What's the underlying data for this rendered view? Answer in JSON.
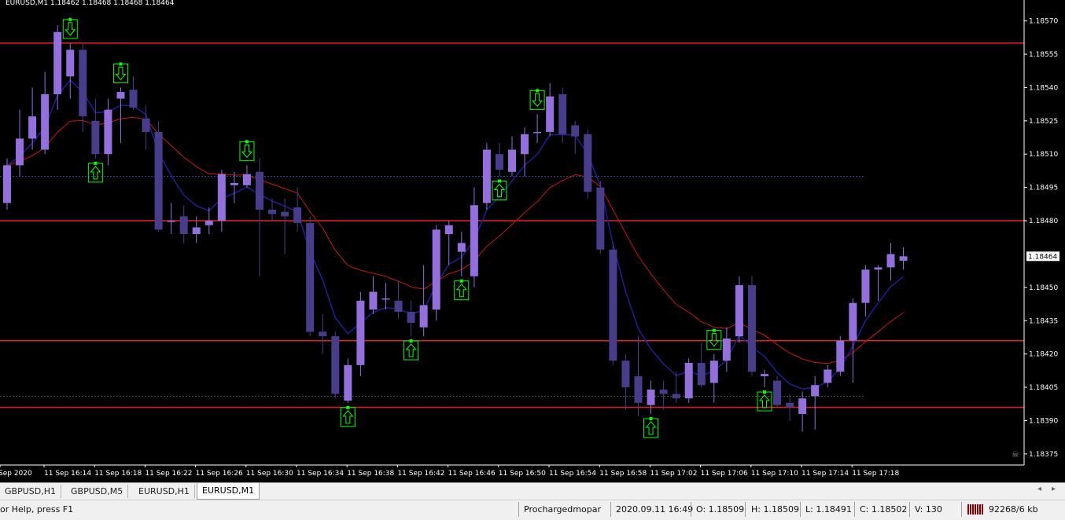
{
  "window": {
    "title": "EURUSD,M1  1.18462 1.18468 1.18468 1.18464"
  },
  "chart": {
    "background": "#000000",
    "bull_color": "#9370db",
    "bear_color": "#483d8b",
    "level_color": "#e0202a",
    "ma_fast_color": "#1e1e96",
    "ma_slow_color": "#c81414",
    "signal_color": "#00ff00",
    "current_price": "1.18464",
    "price_ticks": [
      "1.18570",
      "1.18555",
      "1.18540",
      "1.18525",
      "1.18510",
      "1.18495",
      "1.18480",
      "1.18450",
      "1.18435",
      "1.18420",
      "1.18405",
      "1.18390",
      "1.18375"
    ],
    "time_ticks": [
      "Sep 2020",
      "11 Sep 16:14",
      "11 Sep 16:18",
      "11 Sep 16:22",
      "11 Sep 16:26",
      "11 Sep 16:30",
      "11 Sep 16:34",
      "11 Sep 16:38",
      "11 Sep 16:42",
      "11 Sep 16:46",
      "11 Sep 16:50",
      "11 Sep 16:54",
      "11 Sep 16:58",
      "11 Sep 17:02",
      "11 Sep 17:06",
      "11 Sep 17:10",
      "11 Sep 17:14",
      "11 Sep 17:18"
    ],
    "horizontal_levels": [
      1.1856,
      1.1848,
      1.18426,
      1.18396
    ],
    "dotted_levels": [
      1.185,
      1.18401
    ]
  },
  "chart_data": {
    "type": "candlestick",
    "symbol": "EURUSD",
    "timeframe": "M1",
    "ylim": [
      1.1837,
      1.18578
    ],
    "candles": [
      {
        "o": 1.18488,
        "h": 1.18508,
        "l": 1.18485,
        "c": 1.18505
      },
      {
        "o": 1.18505,
        "h": 1.1853,
        "l": 1.185,
        "c": 1.18517
      },
      {
        "o": 1.18517,
        "h": 1.1854,
        "l": 1.18512,
        "c": 1.18527
      },
      {
        "o": 1.18512,
        "h": 1.18547,
        "l": 1.1851,
        "c": 1.18537
      },
      {
        "o": 1.18537,
        "h": 1.18568,
        "l": 1.1853,
        "c": 1.18565
      },
      {
        "o": 1.18545,
        "h": 1.1856,
        "l": 1.18535,
        "c": 1.18557
      },
      {
        "o": 1.18557,
        "h": 1.1856,
        "l": 1.1852,
        "c": 1.18527
      },
      {
        "o": 1.18525,
        "h": 1.18535,
        "l": 1.18508,
        "c": 1.1851
      },
      {
        "o": 1.1851,
        "h": 1.18535,
        "l": 1.18505,
        "c": 1.1853
      },
      {
        "o": 1.18535,
        "h": 1.1854,
        "l": 1.18515,
        "c": 1.18538
      },
      {
        "o": 1.18539,
        "h": 1.18545,
        "l": 1.1853,
        "c": 1.18531
      },
      {
        "o": 1.18526,
        "h": 1.18532,
        "l": 1.18512,
        "c": 1.1852
      },
      {
        "o": 1.1852,
        "h": 1.18525,
        "l": 1.18475,
        "c": 1.18476
      },
      {
        "o": 1.1848,
        "h": 1.18488,
        "l": 1.18474,
        "c": 1.1848
      },
      {
        "o": 1.18482,
        "h": 1.18487,
        "l": 1.1847,
        "c": 1.18474
      },
      {
        "o": 1.18474,
        "h": 1.18482,
        "l": 1.1847,
        "c": 1.18477
      },
      {
        "o": 1.18478,
        "h": 1.18486,
        "l": 1.18474,
        "c": 1.1848
      },
      {
        "o": 1.1848,
        "h": 1.18503,
        "l": 1.18475,
        "c": 1.18501
      },
      {
        "o": 1.18496,
        "h": 1.18502,
        "l": 1.18488,
        "c": 1.18497
      },
      {
        "o": 1.18496,
        "h": 1.18505,
        "l": 1.18495,
        "c": 1.18501
      },
      {
        "o": 1.18502,
        "h": 1.18508,
        "l": 1.18455,
        "c": 1.18485
      },
      {
        "o": 1.18485,
        "h": 1.1849,
        "l": 1.1848,
        "c": 1.18483
      },
      {
        "o": 1.18484,
        "h": 1.1849,
        "l": 1.18465,
        "c": 1.18482
      },
      {
        "o": 1.18486,
        "h": 1.18495,
        "l": 1.18475,
        "c": 1.18479
      },
      {
        "o": 1.18479,
        "h": 1.18482,
        "l": 1.18428,
        "c": 1.1843
      },
      {
        "o": 1.1843,
        "h": 1.18438,
        "l": 1.1842,
        "c": 1.18428
      },
      {
        "o": 1.18428,
        "h": 1.1843,
        "l": 1.184,
        "c": 1.18402
      },
      {
        "o": 1.18399,
        "h": 1.18418,
        "l": 1.18398,
        "c": 1.18415
      },
      {
        "o": 1.18415,
        "h": 1.18448,
        "l": 1.1841,
        "c": 1.18444
      },
      {
        "o": 1.1844,
        "h": 1.18455,
        "l": 1.18438,
        "c": 1.18448
      },
      {
        "o": 1.18445,
        "h": 1.18452,
        "l": 1.1844,
        "c": 1.18445
      },
      {
        "o": 1.18444,
        "h": 1.18453,
        "l": 1.18436,
        "c": 1.18439
      },
      {
        "o": 1.18439,
        "h": 1.18444,
        "l": 1.18428,
        "c": 1.18434
      },
      {
        "o": 1.18432,
        "h": 1.1846,
        "l": 1.18428,
        "c": 1.18442
      },
      {
        "o": 1.1844,
        "h": 1.18478,
        "l": 1.18435,
        "c": 1.18476
      },
      {
        "o": 1.18474,
        "h": 1.1848,
        "l": 1.1846,
        "c": 1.18478
      },
      {
        "o": 1.18466,
        "h": 1.18475,
        "l": 1.18455,
        "c": 1.1847
      },
      {
        "o": 1.18455,
        "h": 1.18495,
        "l": 1.1845,
        "c": 1.18487
      },
      {
        "o": 1.18488,
        "h": 1.18515,
        "l": 1.18485,
        "c": 1.18512
      },
      {
        "o": 1.1851,
        "h": 1.18515,
        "l": 1.185,
        "c": 1.18503
      },
      {
        "o": 1.18502,
        "h": 1.18518,
        "l": 1.185,
        "c": 1.18512
      },
      {
        "o": 1.1851,
        "h": 1.18522,
        "l": 1.185,
        "c": 1.18519
      },
      {
        "o": 1.1852,
        "h": 1.18528,
        "l": 1.18515,
        "c": 1.1852
      },
      {
        "o": 1.1852,
        "h": 1.18542,
        "l": 1.18518,
        "c": 1.18536
      },
      {
        "o": 1.18537,
        "h": 1.1854,
        "l": 1.18515,
        "c": 1.18519
      },
      {
        "o": 1.18523,
        "h": 1.18525,
        "l": 1.1851,
        "c": 1.18518
      },
      {
        "o": 1.18519,
        "h": 1.18521,
        "l": 1.1849,
        "c": 1.18493
      },
      {
        "o": 1.18495,
        "h": 1.18498,
        "l": 1.18465,
        "c": 1.18467
      },
      {
        "o": 1.18467,
        "h": 1.1847,
        "l": 1.18415,
        "c": 1.18417
      },
      {
        "o": 1.18417,
        "h": 1.1842,
        "l": 1.18395,
        "c": 1.18405
      },
      {
        "o": 1.1841,
        "h": 1.18428,
        "l": 1.18392,
        "c": 1.18398
      },
      {
        "o": 1.18397,
        "h": 1.18408,
        "l": 1.18393,
        "c": 1.18404
      },
      {
        "o": 1.18404,
        "h": 1.18408,
        "l": 1.18395,
        "c": 1.18402
      },
      {
        "o": 1.18402,
        "h": 1.18412,
        "l": 1.18398,
        "c": 1.184
      },
      {
        "o": 1.184,
        "h": 1.18418,
        "l": 1.18398,
        "c": 1.18416
      },
      {
        "o": 1.18416,
        "h": 1.18425,
        "l": 1.18405,
        "c": 1.18406
      },
      {
        "o": 1.18407,
        "h": 1.1842,
        "l": 1.18398,
        "c": 1.18417
      },
      {
        "o": 1.18417,
        "h": 1.18432,
        "l": 1.18412,
        "c": 1.18427
      },
      {
        "o": 1.18428,
        "h": 1.18455,
        "l": 1.18425,
        "c": 1.18451
      },
      {
        "o": 1.18451,
        "h": 1.18455,
        "l": 1.1841,
        "c": 1.18412
      },
      {
        "o": 1.1841,
        "h": 1.18413,
        "l": 1.18405,
        "c": 1.18411
      },
      {
        "o": 1.18408,
        "h": 1.1841,
        "l": 1.18396,
        "c": 1.18397
      },
      {
        "o": 1.18398,
        "h": 1.18402,
        "l": 1.1839,
        "c": 1.18396
      },
      {
        "o": 1.18393,
        "h": 1.18403,
        "l": 1.18385,
        "c": 1.184
      },
      {
        "o": 1.18401,
        "h": 1.1841,
        "l": 1.18386,
        "c": 1.18406
      },
      {
        "o": 1.18407,
        "h": 1.18415,
        "l": 1.18405,
        "c": 1.18413
      },
      {
        "o": 1.18412,
        "h": 1.18428,
        "l": 1.1841,
        "c": 1.18426
      },
      {
        "o": 1.18426,
        "h": 1.18445,
        "l": 1.18407,
        "c": 1.18443
      },
      {
        "o": 1.18443,
        "h": 1.1846,
        "l": 1.18437,
        "c": 1.18458
      },
      {
        "o": 1.18458,
        "h": 1.1846,
        "l": 1.18444,
        "c": 1.18459
      },
      {
        "o": 1.18459,
        "h": 1.1847,
        "l": 1.18453,
        "c": 1.18465
      },
      {
        "o": 1.18462,
        "h": 1.18468,
        "l": 1.18458,
        "c": 1.18464
      }
    ],
    "signals": [
      {
        "dir": "down",
        "candle": 5
      },
      {
        "dir": "up",
        "candle": 7
      },
      {
        "dir": "down",
        "candle": 9
      },
      {
        "dir": "down",
        "candle": 19
      },
      {
        "dir": "up",
        "candle": 27
      },
      {
        "dir": "up",
        "candle": 32
      },
      {
        "dir": "up",
        "candle": 36
      },
      {
        "dir": "up",
        "candle": 39
      },
      {
        "dir": "down",
        "candle": 42
      },
      {
        "dir": "up",
        "candle": 51
      },
      {
        "dir": "down",
        "candle": 56
      },
      {
        "dir": "up",
        "candle": 60
      }
    ]
  },
  "tabs": [
    {
      "label": "GBPUSD,H1",
      "active": false
    },
    {
      "label": "GBPUSD,M5",
      "active": false
    },
    {
      "label": "EURUSD,H1",
      "active": false
    },
    {
      "label": "EURUSD,M1",
      "active": true
    }
  ],
  "tab_nav": {
    "left": "◂",
    "right": "▸"
  },
  "status": {
    "help": "or Help, press F1",
    "profile": "Prochargedmopar",
    "datetime": "2020.09.11 16:49",
    "open": "O: 1.18509",
    "high": "H: 1.18509",
    "low": "L: 1.18491",
    "close": "C: 1.18502",
    "volume": "V: 130",
    "traffic": "92268/6 kb"
  }
}
